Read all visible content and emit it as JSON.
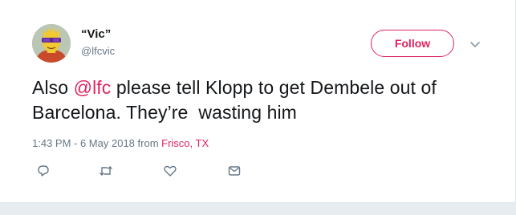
{
  "user": {
    "display_name": "“Vic”",
    "handle": "@lfcvic",
    "avatar_icon": "cartoon-character-sunglasses-avatar"
  },
  "follow_button": {
    "label": "Follow"
  },
  "caret_icon": "chevron-down-icon",
  "tweet": {
    "text_before": "Also ",
    "mention": "@lfc",
    "text_after": " please tell Klopp to get Dembele out of Barcelona. They’re  wasting him"
  },
  "meta": {
    "timestamp": "1:43 PM - 6 May 2018",
    "from_label": " from ",
    "location": "Frisco, TX"
  },
  "actions": [
    {
      "icon": "reply-icon"
    },
    {
      "icon": "retweet-icon"
    },
    {
      "icon": "like-heart-icon"
    },
    {
      "icon": "direct-message-icon"
    }
  ],
  "colors": {
    "accent": "#e0245e",
    "text": "#14171a",
    "secondary": "#657786",
    "background": "#e6ecf0"
  }
}
